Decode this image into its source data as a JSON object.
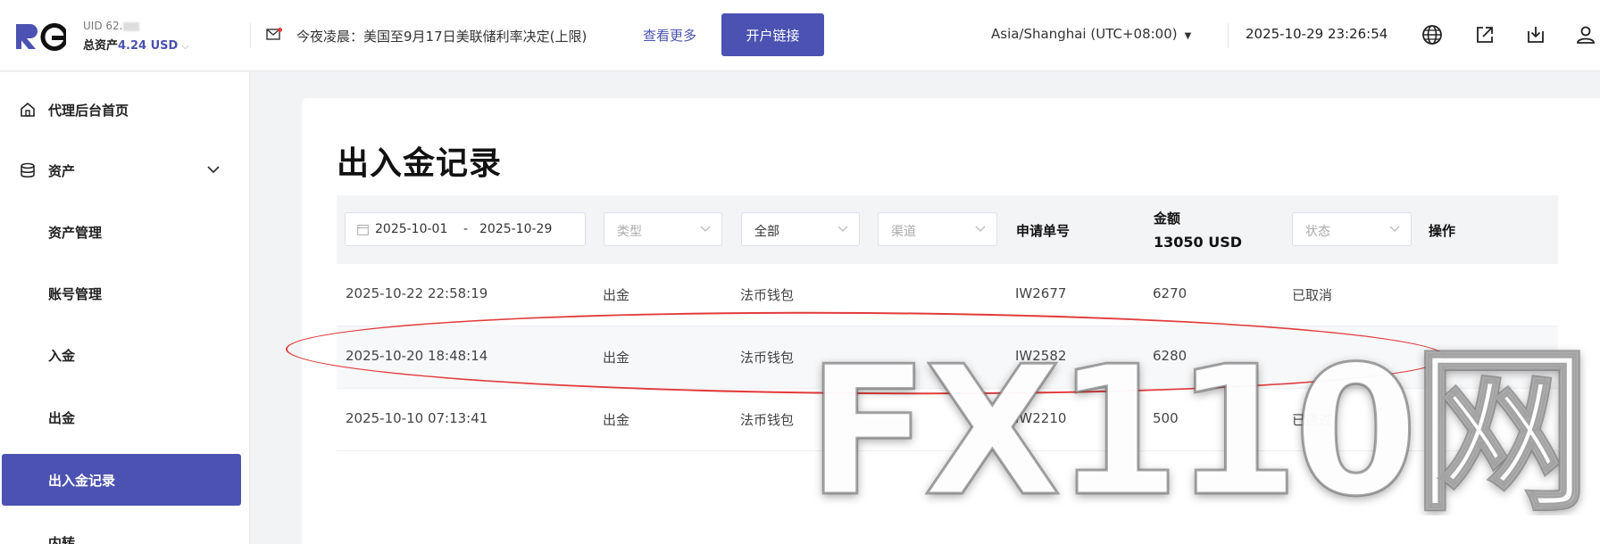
{
  "header": {
    "uid_label": "UID 62.",
    "assets_label": "总资产",
    "assets_value": "4.24 USD",
    "notice": "今夜凌晨：美国至9月17日美联储利率决定(上限)",
    "more_link": "查看更多",
    "open_link_button": "开户链接",
    "timezone": "Asia/Shanghai (UTC+08:00)",
    "datetime": "2025-10-29 23:26:54",
    "icons": [
      "globe-icon",
      "external-link-icon",
      "download-icon",
      "user-icon"
    ]
  },
  "sidebar": {
    "items": [
      {
        "label": "代理后台首页",
        "icon": "home-icon"
      },
      {
        "label": "资产",
        "icon": "database-icon"
      },
      {
        "label": "资产管理"
      },
      {
        "label": "账号管理"
      },
      {
        "label": "入金"
      },
      {
        "label": "出金"
      },
      {
        "label": "出入金记录",
        "active": true
      },
      {
        "label": "内转"
      }
    ]
  },
  "page": {
    "title": "出入金记录"
  },
  "filters": {
    "date_start": "2025-10-01",
    "date_sep": "-",
    "date_end": "2025-10-29",
    "type_placeholder": "类型",
    "all_value": "全部",
    "channel_placeholder": "渠道",
    "status_placeholder": "状态"
  },
  "columns": {
    "order_no": "申请单号",
    "amount": "金额",
    "amount_total": "13050 USD",
    "action": "操作"
  },
  "rows": [
    {
      "time": "2025-10-22 22:58:19",
      "type": "出金",
      "channel": "法币钱包",
      "order": "IW2677",
      "amount": "6270",
      "status": "已取消"
    },
    {
      "time": "2025-10-20 18:48:14",
      "type": "出金",
      "channel": "法币钱包",
      "order": "IW2582",
      "amount": "6280",
      "status": ""
    },
    {
      "time": "2025-10-10 07:13:41",
      "type": "出金",
      "channel": "法币钱包",
      "order": "IW2210",
      "amount": "500",
      "status": "已通过"
    }
  ],
  "watermark": "FX110网",
  "colors": {
    "accent": "#4b52b1",
    "annotation": "#e23b3b"
  }
}
